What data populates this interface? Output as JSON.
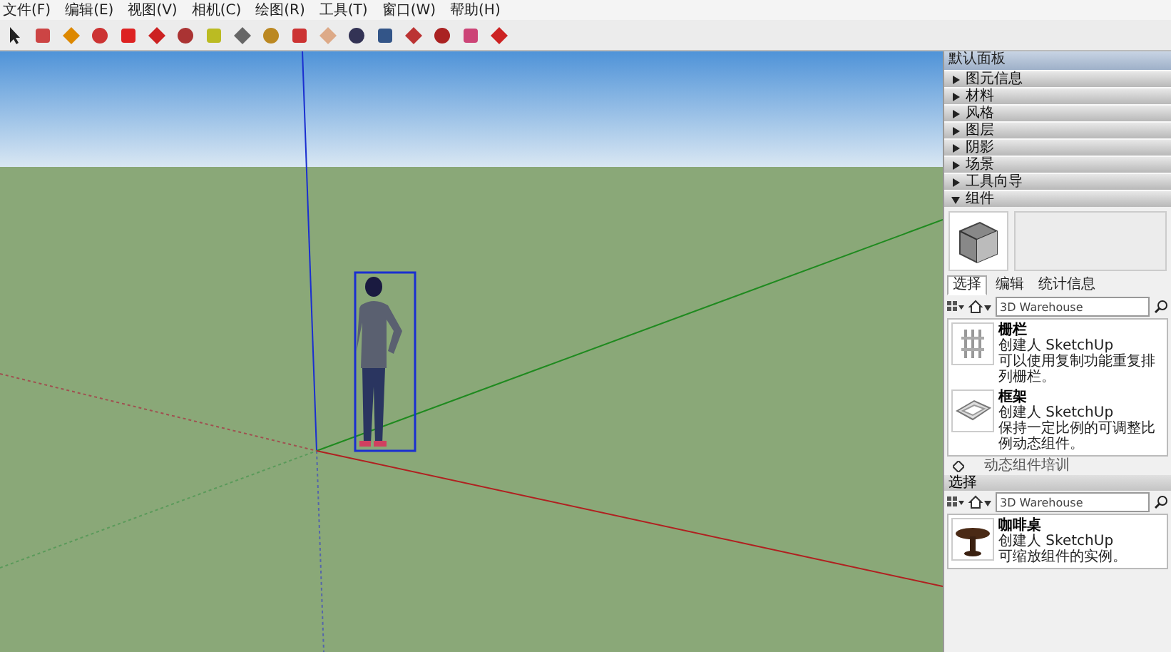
{
  "menu": [
    "文件(F)",
    "编辑(E)",
    "视图(V)",
    "相机(C)",
    "绘图(R)",
    "工具(T)",
    "窗口(W)",
    "帮助(H)"
  ],
  "tray": {
    "title": "默认面板",
    "sections": [
      {
        "label": "图元信息",
        "expanded": false
      },
      {
        "label": "材料",
        "expanded": false
      },
      {
        "label": "风格",
        "expanded": false
      },
      {
        "label": "图层",
        "expanded": false
      },
      {
        "label": "阴影",
        "expanded": false
      },
      {
        "label": "场景",
        "expanded": false
      },
      {
        "label": "工具向导",
        "expanded": false
      },
      {
        "label": "组件",
        "expanded": true
      }
    ]
  },
  "components": {
    "tabs": [
      {
        "label": "选择",
        "selected": true
      },
      {
        "label": "编辑",
        "selected": false
      },
      {
        "label": "统计信息",
        "selected": false
      }
    ],
    "search": {
      "value": "3D Warehouse"
    },
    "items": [
      {
        "name": "栅栏",
        "creator": "创建人 SketchUp",
        "description": "可以使用复制功能重复排列栅栏。",
        "kind": "fence"
      },
      {
        "name": "框架",
        "creator": "创建人 SketchUp",
        "description": "保持一定比例的可调整比例动态组件。",
        "kind": "frame"
      }
    ],
    "footer": "动态组件培训"
  },
  "secondary": {
    "title": "选择",
    "search": {
      "value": "3D Warehouse"
    },
    "items": [
      {
        "name": "咖啡桌",
        "creator": "创建人 SketchUp",
        "description": "可缩放组件的实例。",
        "kind": "table"
      }
    ]
  }
}
